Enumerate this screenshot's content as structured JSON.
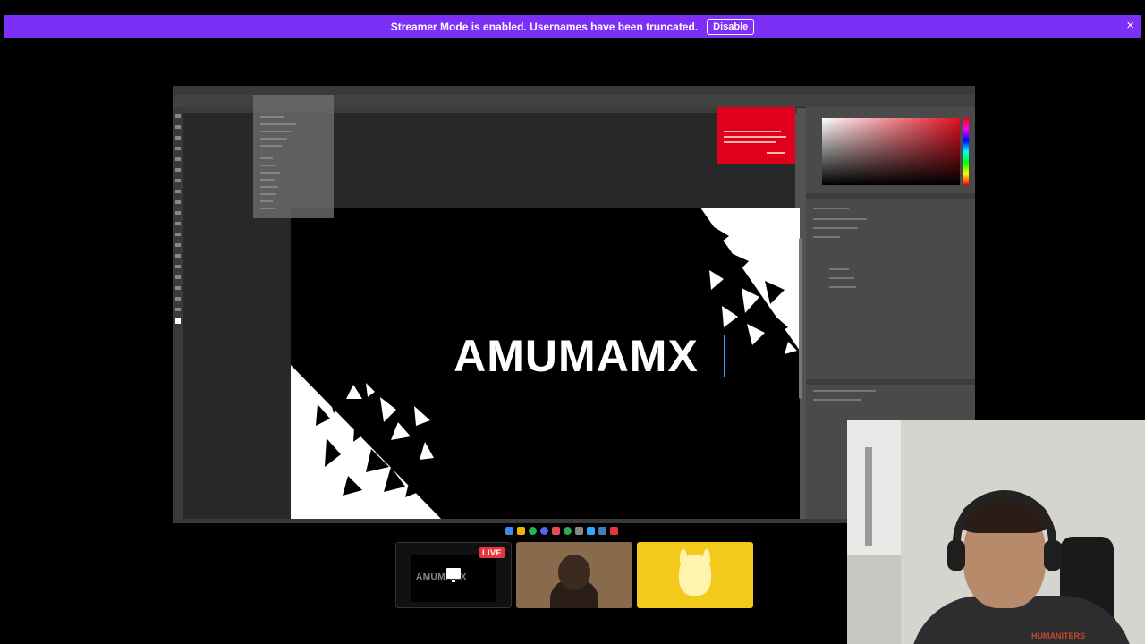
{
  "banner": {
    "text": "Streamer Mode is enabled. Usernames have been truncated.",
    "disable_label": "Disable",
    "close_icon": "×"
  },
  "photoshop": {
    "canvas_text": "AMUMAMX"
  },
  "tiles": {
    "screen": {
      "live_label": "LIVE",
      "preview_text": "AMUMAMX"
    },
    "avatar": {},
    "pikachu": {}
  },
  "webcam": {
    "shirt_text": "HUMANITERS"
  },
  "colors": {
    "banner": "#7b2ff7",
    "live": "#e8353b",
    "ps_popup": "#e0001b",
    "pikachu_bg": "#f3c91a"
  }
}
